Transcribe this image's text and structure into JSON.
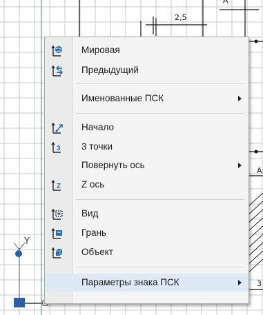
{
  "drawing": {
    "dimension_label": "2,5",
    "partial_label_a_top": "A",
    "partial_label_a_right": "A",
    "partial_label_3": "3",
    "axis_y_label": "Y"
  },
  "context_menu": {
    "items": [
      {
        "label": "Мировая",
        "icon": "ucs-world-icon",
        "submenu": false
      },
      {
        "label": "Предыдущий",
        "icon": "ucs-previous-icon",
        "submenu": false
      },
      {
        "label": "Именованные ПСК",
        "icon": "",
        "submenu": true
      },
      {
        "label": "Начало",
        "icon": "ucs-origin-icon",
        "submenu": false
      },
      {
        "label": "3 точки",
        "icon": "ucs-3point-icon",
        "submenu": false
      },
      {
        "label": "Повернуть ось",
        "icon": "",
        "submenu": true
      },
      {
        "label": "Z ось",
        "icon": "ucs-z-axis-icon",
        "submenu": false
      },
      {
        "label": "Вид",
        "icon": "ucs-view-icon",
        "submenu": false
      },
      {
        "label": "Грань",
        "icon": "ucs-face-icon",
        "submenu": false
      },
      {
        "label": "Объект",
        "icon": "ucs-object-icon",
        "submenu": false
      },
      {
        "label": "Параметры знака ПСК",
        "icon": "",
        "submenu": true
      }
    ]
  },
  "colors": {
    "ucs_icon_blue": "#1e6fb8",
    "ucs_marker_blue": "#2a5faa",
    "grid_line": "#c8c8c8",
    "drawing_line": "#111111"
  }
}
